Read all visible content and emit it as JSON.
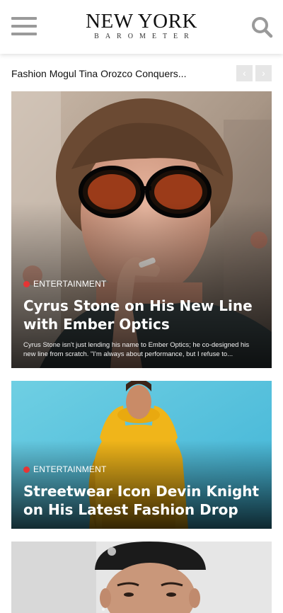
{
  "header": {
    "logo_main": "NEW YORK",
    "logo_sub": "BAROMETER",
    "menu_icon": "hamburger-menu-icon",
    "search_icon": "search-icon"
  },
  "ticker": {
    "headline": "Fashion Mogul Tina Orozco Conquers...",
    "prev_label": "‹",
    "next_label": "›"
  },
  "articles": [
    {
      "category": "ENTERTAINMENT",
      "title": "Cyrus Stone on His New Line with Ember Optics",
      "excerpt": "Cyrus Stone isn't just lending his name to Ember Optics; he co-designed his new line from scratch. \"I'm always about performance, but I refuse to..."
    },
    {
      "category": "ENTERTAINMENT",
      "title": "Streetwear Icon Devin Knight on His Latest Fashion Drop"
    },
    {
      "category": "",
      "title": ""
    }
  ],
  "colors": {
    "category_dot": "#e53535",
    "icon_gray": "#9a9a9a",
    "arrow_bg": "#e6e6e6"
  }
}
